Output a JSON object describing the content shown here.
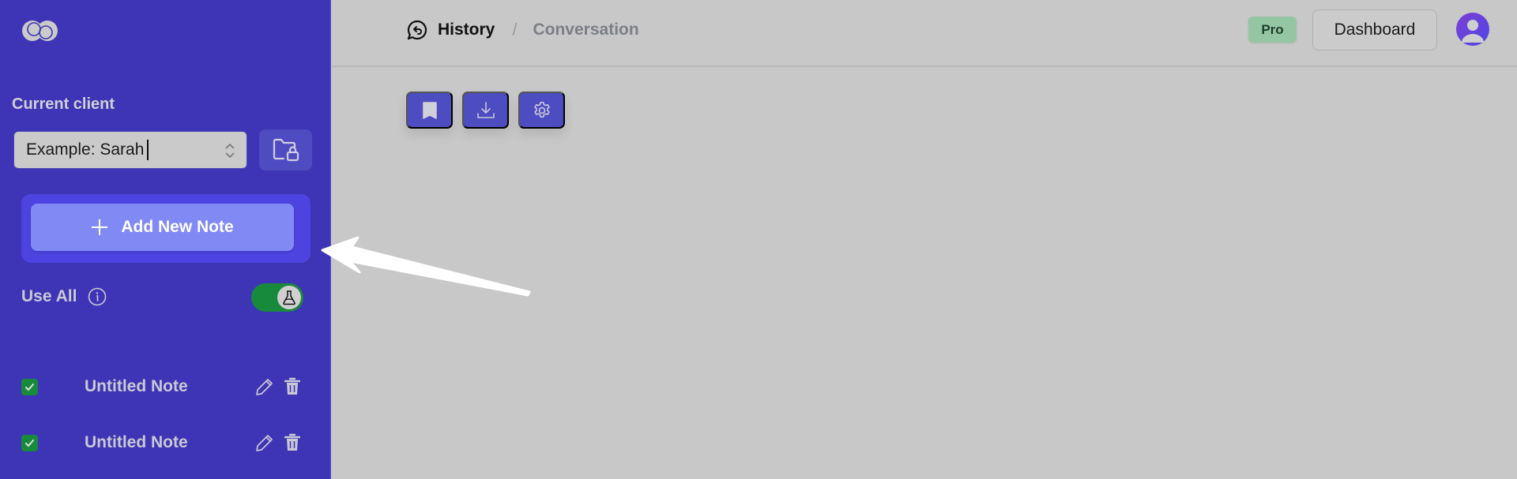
{
  "sidebar": {
    "logo_icon": "logo-overlapping-circles",
    "client_label": "Current client",
    "client_select": {
      "value": "Example: Sarah",
      "icon": "chevron-up-down-icon"
    },
    "folder_lock_icon": "folder-lock-icon",
    "add_note_label": "Add New Note",
    "add_note_icon": "plus-icon",
    "use_all": {
      "label": "Use All",
      "info_icon": "info-icon",
      "toggle_on": true,
      "toggle_icon": "flask-icon"
    },
    "notes": [
      {
        "title": "Untitled Note",
        "checked": true
      },
      {
        "title": "Untitled Note",
        "checked": true
      }
    ]
  },
  "header": {
    "breadcrumb": {
      "icon": "chat-history-icon",
      "items": [
        "History",
        "Conversation"
      ],
      "separator": "/"
    },
    "badge": "Pro",
    "dashboard_label": "Dashboard",
    "avatar_icon": "user-avatar-icon"
  },
  "toolbar": {
    "buttons": [
      {
        "name": "bookmark",
        "icon": "bookmark-icon"
      },
      {
        "name": "download",
        "icon": "download-icon"
      },
      {
        "name": "settings",
        "icon": "gear-icon"
      }
    ]
  },
  "annotation": {
    "type": "arrow",
    "points_to": "add-new-note-button"
  },
  "colors": {
    "sidebar_bg": "#3d35b5",
    "accent": "#4d4cc1",
    "add_note_btn": "#8189f5",
    "toggle_on": "#188a3c",
    "pro_badge": "#95c6a4",
    "main_bg": "#c8c8c8"
  }
}
